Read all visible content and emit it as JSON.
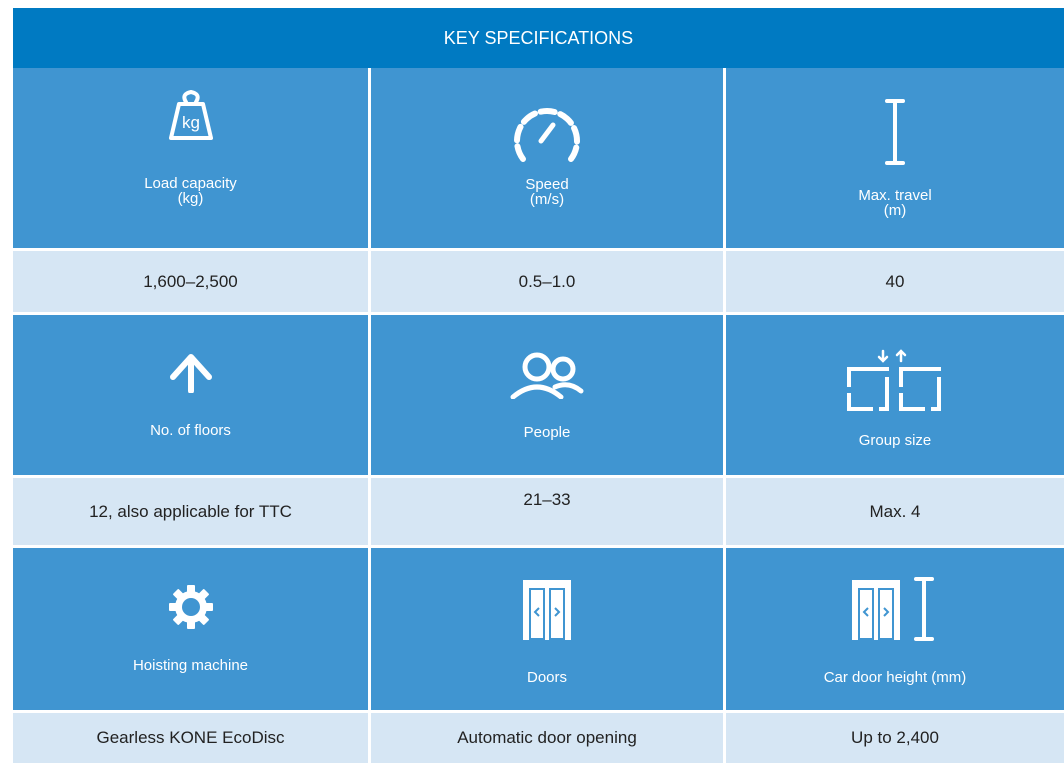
{
  "title": "KEY SPECIFICATIONS",
  "rows": [
    {
      "items": [
        {
          "icon": "weight-kg-icon",
          "label": "Load capacity",
          "sublabel": "(kg)",
          "value": "1,600–2,500"
        },
        {
          "icon": "speedometer-icon",
          "label": "Speed",
          "sublabel": "(m/s)",
          "value": "0.5–1.0"
        },
        {
          "icon": "travel-height-icon",
          "label": "Max. travel",
          "sublabel": "(m)",
          "value": "40"
        }
      ]
    },
    {
      "items": [
        {
          "icon": "arrow-up-icon",
          "label": "No. of floors",
          "value": "12, also applicable for TTC"
        },
        {
          "icon": "people-icon",
          "label": "People",
          "value": "21–33"
        },
        {
          "icon": "group-elevators-icon",
          "label": "Group size",
          "value": "Max. 4"
        }
      ]
    },
    {
      "items": [
        {
          "icon": "gear-icon",
          "label": "Hoisting machine",
          "value": "Gearless KONE EcoDisc"
        },
        {
          "icon": "doors-icon",
          "label": "Doors",
          "value": "Automatic door opening"
        },
        {
          "icon": "door-height-icon",
          "label": "Car door height (mm)",
          "value": "Up to 2,400"
        }
      ]
    }
  ],
  "colors": {
    "header": "#007ac2",
    "icon_cells": "#4095d1",
    "value_cells": "#d6e6f4",
    "text_dark": "#222222"
  }
}
